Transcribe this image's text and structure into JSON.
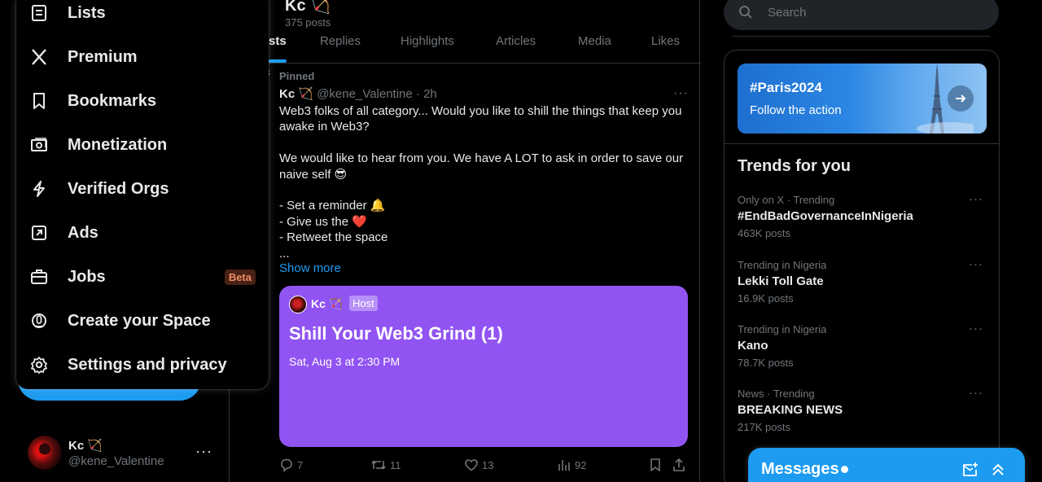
{
  "menu": {
    "items": [
      {
        "label": "Lists",
        "icon": "list-icon"
      },
      {
        "label": "Premium",
        "icon": "x-logo-icon"
      },
      {
        "label": "Bookmarks",
        "icon": "bookmark-icon"
      },
      {
        "label": "Monetization",
        "icon": "monetization-icon"
      },
      {
        "label": "Verified Orgs",
        "icon": "lightning-icon"
      },
      {
        "label": "Ads",
        "icon": "ads-icon"
      },
      {
        "label": "Jobs",
        "icon": "briefcase-icon",
        "badge": "Beta"
      },
      {
        "label": "Create your Space",
        "icon": "microphone-icon"
      },
      {
        "label": "Settings and privacy",
        "icon": "gear-icon"
      }
    ]
  },
  "account": {
    "name": "Kc 🏹",
    "handle": "@kene_Valentine",
    "more": "···"
  },
  "profile": {
    "name": "Kc 🏹",
    "post_count": "375 posts"
  },
  "tabs": {
    "items": [
      "Posts",
      "Replies",
      "Highlights",
      "Articles",
      "Media",
      "Likes"
    ],
    "visible_active": "sts"
  },
  "post": {
    "pinned_label": "Pinned",
    "author": "Kc 🏹",
    "handle_time": "@kene_Valentine · 2h",
    "body": "Web3 folks of all category... Would you like to shill the things that keep you awake in Web3?\n\nWe would like to hear from you. We have A LOT to ask in order to save our naive self 😎\n\n- Set a reminder 🔔\n- Give us the ❤️\n- Retweet the space\n...",
    "show_more": "Show more",
    "more": "···",
    "space": {
      "host_name": "Kc 🏹",
      "host_badge": "Host",
      "title": "Shill Your Web3 Grind (1)",
      "date": "Sat, Aug 3 at 2:30 PM",
      "color": "#9154f2"
    },
    "stats": {
      "replies": "7",
      "reposts": "11",
      "likes": "13",
      "views": "92"
    }
  },
  "search": {
    "placeholder": "Search"
  },
  "event": {
    "title": "#Paris2024",
    "subtitle": "Follow the action"
  },
  "trends": {
    "title": "Trends for you",
    "items": [
      {
        "meta": "Only on X · Trending",
        "name": "#EndBadGovernanceInNigeria",
        "count": "463K posts"
      },
      {
        "meta": "Trending in Nigeria",
        "name": "Lekki Toll Gate",
        "count": "16.9K posts"
      },
      {
        "meta": "Trending in Nigeria",
        "name": "Kano",
        "count": "78.7K posts"
      },
      {
        "meta": "News · Trending",
        "name": "BREAKING NEWS",
        "count": "217K posts"
      }
    ]
  },
  "messages": {
    "title": "Messages"
  },
  "colors": {
    "accent": "#1d9bf0",
    "background": "#000000",
    "space_card": "#9154f2",
    "beta_badge": "#4a2115"
  }
}
